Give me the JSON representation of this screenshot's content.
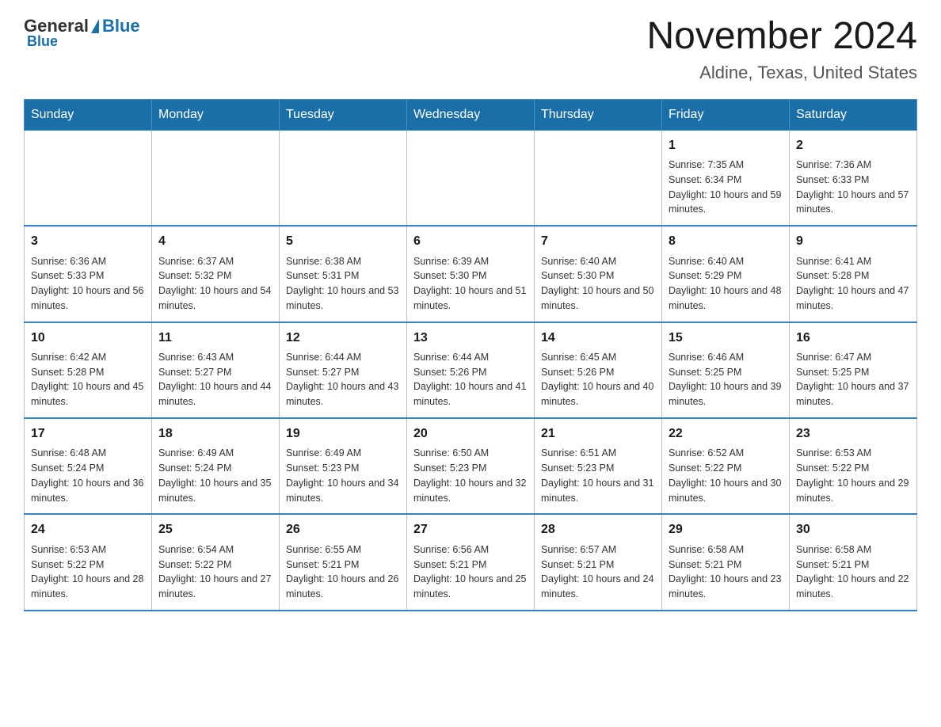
{
  "logo": {
    "general": "General",
    "blue": "Blue"
  },
  "title": "November 2024",
  "subtitle": "Aldine, Texas, United States",
  "days_of_week": [
    "Sunday",
    "Monday",
    "Tuesday",
    "Wednesday",
    "Thursday",
    "Friday",
    "Saturday"
  ],
  "weeks": [
    [
      {
        "day": "",
        "info": ""
      },
      {
        "day": "",
        "info": ""
      },
      {
        "day": "",
        "info": ""
      },
      {
        "day": "",
        "info": ""
      },
      {
        "day": "",
        "info": ""
      },
      {
        "day": "1",
        "info": "Sunrise: 7:35 AM\nSunset: 6:34 PM\nDaylight: 10 hours and 59 minutes."
      },
      {
        "day": "2",
        "info": "Sunrise: 7:36 AM\nSunset: 6:33 PM\nDaylight: 10 hours and 57 minutes."
      }
    ],
    [
      {
        "day": "3",
        "info": "Sunrise: 6:36 AM\nSunset: 5:33 PM\nDaylight: 10 hours and 56 minutes."
      },
      {
        "day": "4",
        "info": "Sunrise: 6:37 AM\nSunset: 5:32 PM\nDaylight: 10 hours and 54 minutes."
      },
      {
        "day": "5",
        "info": "Sunrise: 6:38 AM\nSunset: 5:31 PM\nDaylight: 10 hours and 53 minutes."
      },
      {
        "day": "6",
        "info": "Sunrise: 6:39 AM\nSunset: 5:30 PM\nDaylight: 10 hours and 51 minutes."
      },
      {
        "day": "7",
        "info": "Sunrise: 6:40 AM\nSunset: 5:30 PM\nDaylight: 10 hours and 50 minutes."
      },
      {
        "day": "8",
        "info": "Sunrise: 6:40 AM\nSunset: 5:29 PM\nDaylight: 10 hours and 48 minutes."
      },
      {
        "day": "9",
        "info": "Sunrise: 6:41 AM\nSunset: 5:28 PM\nDaylight: 10 hours and 47 minutes."
      }
    ],
    [
      {
        "day": "10",
        "info": "Sunrise: 6:42 AM\nSunset: 5:28 PM\nDaylight: 10 hours and 45 minutes."
      },
      {
        "day": "11",
        "info": "Sunrise: 6:43 AM\nSunset: 5:27 PM\nDaylight: 10 hours and 44 minutes."
      },
      {
        "day": "12",
        "info": "Sunrise: 6:44 AM\nSunset: 5:27 PM\nDaylight: 10 hours and 43 minutes."
      },
      {
        "day": "13",
        "info": "Sunrise: 6:44 AM\nSunset: 5:26 PM\nDaylight: 10 hours and 41 minutes."
      },
      {
        "day": "14",
        "info": "Sunrise: 6:45 AM\nSunset: 5:26 PM\nDaylight: 10 hours and 40 minutes."
      },
      {
        "day": "15",
        "info": "Sunrise: 6:46 AM\nSunset: 5:25 PM\nDaylight: 10 hours and 39 minutes."
      },
      {
        "day": "16",
        "info": "Sunrise: 6:47 AM\nSunset: 5:25 PM\nDaylight: 10 hours and 37 minutes."
      }
    ],
    [
      {
        "day": "17",
        "info": "Sunrise: 6:48 AM\nSunset: 5:24 PM\nDaylight: 10 hours and 36 minutes."
      },
      {
        "day": "18",
        "info": "Sunrise: 6:49 AM\nSunset: 5:24 PM\nDaylight: 10 hours and 35 minutes."
      },
      {
        "day": "19",
        "info": "Sunrise: 6:49 AM\nSunset: 5:23 PM\nDaylight: 10 hours and 34 minutes."
      },
      {
        "day": "20",
        "info": "Sunrise: 6:50 AM\nSunset: 5:23 PM\nDaylight: 10 hours and 32 minutes."
      },
      {
        "day": "21",
        "info": "Sunrise: 6:51 AM\nSunset: 5:23 PM\nDaylight: 10 hours and 31 minutes."
      },
      {
        "day": "22",
        "info": "Sunrise: 6:52 AM\nSunset: 5:22 PM\nDaylight: 10 hours and 30 minutes."
      },
      {
        "day": "23",
        "info": "Sunrise: 6:53 AM\nSunset: 5:22 PM\nDaylight: 10 hours and 29 minutes."
      }
    ],
    [
      {
        "day": "24",
        "info": "Sunrise: 6:53 AM\nSunset: 5:22 PM\nDaylight: 10 hours and 28 minutes."
      },
      {
        "day": "25",
        "info": "Sunrise: 6:54 AM\nSunset: 5:22 PM\nDaylight: 10 hours and 27 minutes."
      },
      {
        "day": "26",
        "info": "Sunrise: 6:55 AM\nSunset: 5:21 PM\nDaylight: 10 hours and 26 minutes."
      },
      {
        "day": "27",
        "info": "Sunrise: 6:56 AM\nSunset: 5:21 PM\nDaylight: 10 hours and 25 minutes."
      },
      {
        "day": "28",
        "info": "Sunrise: 6:57 AM\nSunset: 5:21 PM\nDaylight: 10 hours and 24 minutes."
      },
      {
        "day": "29",
        "info": "Sunrise: 6:58 AM\nSunset: 5:21 PM\nDaylight: 10 hours and 23 minutes."
      },
      {
        "day": "30",
        "info": "Sunrise: 6:58 AM\nSunset: 5:21 PM\nDaylight: 10 hours and 22 minutes."
      }
    ]
  ]
}
